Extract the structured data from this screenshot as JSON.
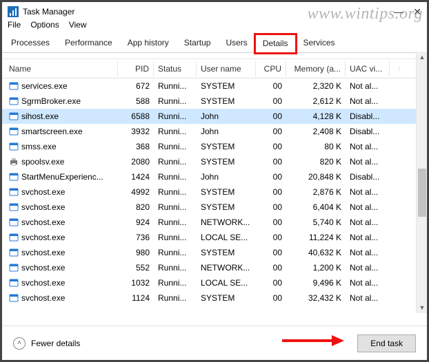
{
  "watermark": "www.wintips.org",
  "window": {
    "title": "Task Manager"
  },
  "menu": {
    "items": [
      "File",
      "Options",
      "View"
    ]
  },
  "tabs": {
    "items": [
      "Processes",
      "Performance",
      "App history",
      "Startup",
      "Users",
      "Details",
      "Services"
    ],
    "active": "Details",
    "highlighted": "Details"
  },
  "columns": [
    "Name",
    "PID",
    "Status",
    "User name",
    "CPU",
    "Memory (a...",
    "UAC vi..."
  ],
  "rows": [
    {
      "icon": "app",
      "name": "services.exe",
      "pid": "672",
      "status": "Runni...",
      "user": "SYSTEM",
      "cpu": "00",
      "mem": "2,320 K",
      "uac": "Not al...",
      "selected": false
    },
    {
      "icon": "app",
      "name": "SgrmBroker.exe",
      "pid": "588",
      "status": "Runni...",
      "user": "SYSTEM",
      "cpu": "00",
      "mem": "2,612 K",
      "uac": "Not al...",
      "selected": false
    },
    {
      "icon": "app",
      "name": "sihost.exe",
      "pid": "6588",
      "status": "Runni...",
      "user": "John",
      "cpu": "00",
      "mem": "4,128 K",
      "uac": "Disabl...",
      "selected": true
    },
    {
      "icon": "app",
      "name": "smartscreen.exe",
      "pid": "3932",
      "status": "Runni...",
      "user": "John",
      "cpu": "00",
      "mem": "2,408 K",
      "uac": "Disabl...",
      "selected": false
    },
    {
      "icon": "app",
      "name": "smss.exe",
      "pid": "368",
      "status": "Runni...",
      "user": "SYSTEM",
      "cpu": "00",
      "mem": "80 K",
      "uac": "Not al...",
      "selected": false
    },
    {
      "icon": "print",
      "name": "spoolsv.exe",
      "pid": "2080",
      "status": "Runni...",
      "user": "SYSTEM",
      "cpu": "00",
      "mem": "820 K",
      "uac": "Not al...",
      "selected": false
    },
    {
      "icon": "app",
      "name": "StartMenuExperienc...",
      "pid": "1424",
      "status": "Runni...",
      "user": "John",
      "cpu": "00",
      "mem": "20,848 K",
      "uac": "Disabl...",
      "selected": false
    },
    {
      "icon": "app",
      "name": "svchost.exe",
      "pid": "4992",
      "status": "Runni...",
      "user": "SYSTEM",
      "cpu": "00",
      "mem": "2,876 K",
      "uac": "Not al...",
      "selected": false
    },
    {
      "icon": "app",
      "name": "svchost.exe",
      "pid": "820",
      "status": "Runni...",
      "user": "SYSTEM",
      "cpu": "00",
      "mem": "6,404 K",
      "uac": "Not al...",
      "selected": false
    },
    {
      "icon": "app",
      "name": "svchost.exe",
      "pid": "924",
      "status": "Runni...",
      "user": "NETWORK...",
      "cpu": "00",
      "mem": "5,740 K",
      "uac": "Not al...",
      "selected": false
    },
    {
      "icon": "app",
      "name": "svchost.exe",
      "pid": "736",
      "status": "Runni...",
      "user": "LOCAL SE...",
      "cpu": "00",
      "mem": "11,224 K",
      "uac": "Not al...",
      "selected": false
    },
    {
      "icon": "app",
      "name": "svchost.exe",
      "pid": "980",
      "status": "Runni...",
      "user": "SYSTEM",
      "cpu": "00",
      "mem": "40,632 K",
      "uac": "Not al...",
      "selected": false
    },
    {
      "icon": "app",
      "name": "svchost.exe",
      "pid": "552",
      "status": "Runni...",
      "user": "NETWORK...",
      "cpu": "00",
      "mem": "1,200 K",
      "uac": "Not al...",
      "selected": false
    },
    {
      "icon": "app",
      "name": "svchost.exe",
      "pid": "1032",
      "status": "Runni...",
      "user": "LOCAL SE...",
      "cpu": "00",
      "mem": "9,496 K",
      "uac": "Not al...",
      "selected": false
    },
    {
      "icon": "app",
      "name": "svchost.exe",
      "pid": "1124",
      "status": "Runni...",
      "user": "SYSTEM",
      "cpu": "00",
      "mem": "32,432 K",
      "uac": "Not al...",
      "selected": false
    }
  ],
  "footer": {
    "fewer_details": "Fewer details",
    "end_task": "End task"
  }
}
